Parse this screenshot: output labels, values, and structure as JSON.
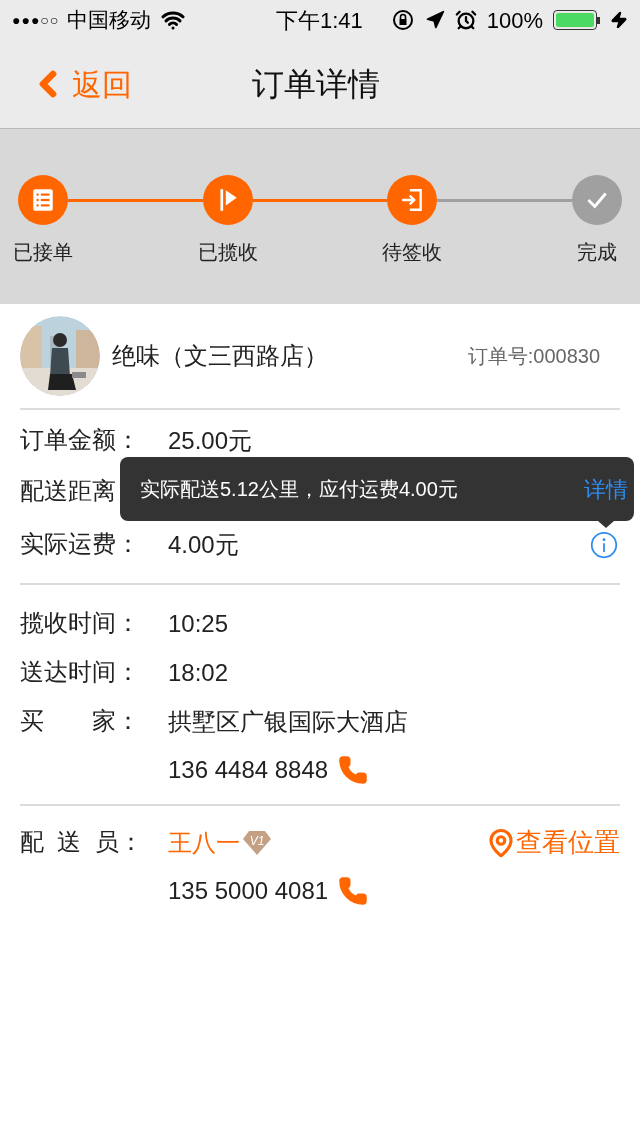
{
  "status_bar": {
    "signal": "●●●○○",
    "carrier": "中国移动",
    "time": "下午1:41",
    "battery": "100%"
  },
  "nav": {
    "back": "返回",
    "title": "订单详情"
  },
  "steps": [
    {
      "label": "已接单",
      "completed": true
    },
    {
      "label": "已揽收",
      "completed": true
    },
    {
      "label": "待签收",
      "completed": true
    },
    {
      "label": "完成",
      "completed": false
    }
  ],
  "shop": {
    "name": "绝味（文三西路店）",
    "order_no": "订单号:000830"
  },
  "fee_rows": [
    {
      "label": "订单金额：",
      "value": "25.00元"
    },
    {
      "label": "配送距离"
    },
    {
      "label": "实际运费：",
      "value": "4.00元",
      "info": true
    }
  ],
  "tooltip": {
    "text": "实际配送5.12公里，应付运费4.00元",
    "link": "详情"
  },
  "time_rows": [
    {
      "label": "揽收时间：",
      "value": "10:25"
    },
    {
      "label": "送达时间：",
      "value": "18:02"
    }
  ],
  "buyer": {
    "label": "买　　家：",
    "address": "拱墅区广银国际大酒店",
    "phone": "136 4484 8848"
  },
  "courier": {
    "label": "配  送  员：",
    "name": "王八一",
    "vip_badge": "V1",
    "locate": "查看位置",
    "phone": "135 5000 4081"
  }
}
